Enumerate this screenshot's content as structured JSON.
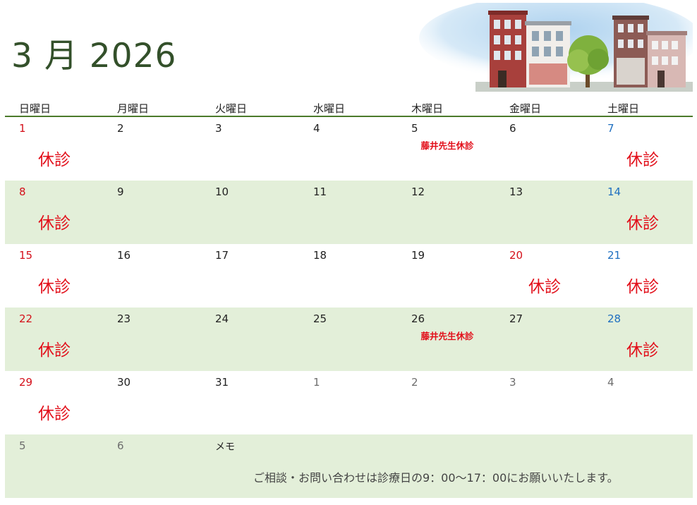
{
  "header": {
    "month_title": "3 月 2026"
  },
  "weekdays": [
    "日曜日",
    "月曜日",
    "火曜日",
    "水曜日",
    "木曜日",
    "金曜日",
    "土曜日"
  ],
  "weeks": [
    [
      {
        "day": "1",
        "type": "sun",
        "closed": "休診"
      },
      {
        "day": "2",
        "type": "cur"
      },
      {
        "day": "3",
        "type": "cur"
      },
      {
        "day": "4",
        "type": "cur"
      },
      {
        "day": "5",
        "type": "cur",
        "note": "藤井先生休診"
      },
      {
        "day": "6",
        "type": "cur"
      },
      {
        "day": "7",
        "type": "sat",
        "closed": "休診"
      }
    ],
    [
      {
        "day": "8",
        "type": "sun",
        "closed": "休診"
      },
      {
        "day": "9",
        "type": "cur"
      },
      {
        "day": "10",
        "type": "cur"
      },
      {
        "day": "11",
        "type": "cur"
      },
      {
        "day": "12",
        "type": "cur"
      },
      {
        "day": "13",
        "type": "cur"
      },
      {
        "day": "14",
        "type": "sat",
        "closed": "休診"
      }
    ],
    [
      {
        "day": "15",
        "type": "sun",
        "closed": "休診"
      },
      {
        "day": "16",
        "type": "cur"
      },
      {
        "day": "17",
        "type": "cur"
      },
      {
        "day": "18",
        "type": "cur"
      },
      {
        "day": "19",
        "type": "cur"
      },
      {
        "day": "20",
        "type": "sun",
        "closed": "休診"
      },
      {
        "day": "21",
        "type": "sat",
        "closed": "休診"
      }
    ],
    [
      {
        "day": "22",
        "type": "sun",
        "closed": "休診"
      },
      {
        "day": "23",
        "type": "cur"
      },
      {
        "day": "24",
        "type": "cur"
      },
      {
        "day": "25",
        "type": "cur"
      },
      {
        "day": "26",
        "type": "cur",
        "note": "藤井先生休診"
      },
      {
        "day": "27",
        "type": "cur"
      },
      {
        "day": "28",
        "type": "sat",
        "closed": "休診"
      }
    ],
    [
      {
        "day": "29",
        "type": "sun",
        "closed": "休診"
      },
      {
        "day": "30",
        "type": "cur"
      },
      {
        "day": "31",
        "type": "cur"
      },
      {
        "day": "1",
        "type": "other"
      },
      {
        "day": "2",
        "type": "other"
      },
      {
        "day": "3",
        "type": "other"
      },
      {
        "day": "4",
        "type": "other"
      }
    ]
  ],
  "last_row": {
    "days": [
      {
        "day": "5",
        "type": "other"
      },
      {
        "day": "6",
        "type": "other"
      }
    ],
    "memo_label": "メモ",
    "memo_text": "ご相談・お問い合わせは診療日の9：00～17：00にお願いいたします。"
  },
  "colors": {
    "accent_green": "#4b7a2b",
    "row_shade": "#e3efd9",
    "sunday_red": "#d4101a",
    "saturday_blue": "#1e6fc0",
    "closed_red": "#e20f1a"
  },
  "illustration": "townhouse-street-illustration"
}
